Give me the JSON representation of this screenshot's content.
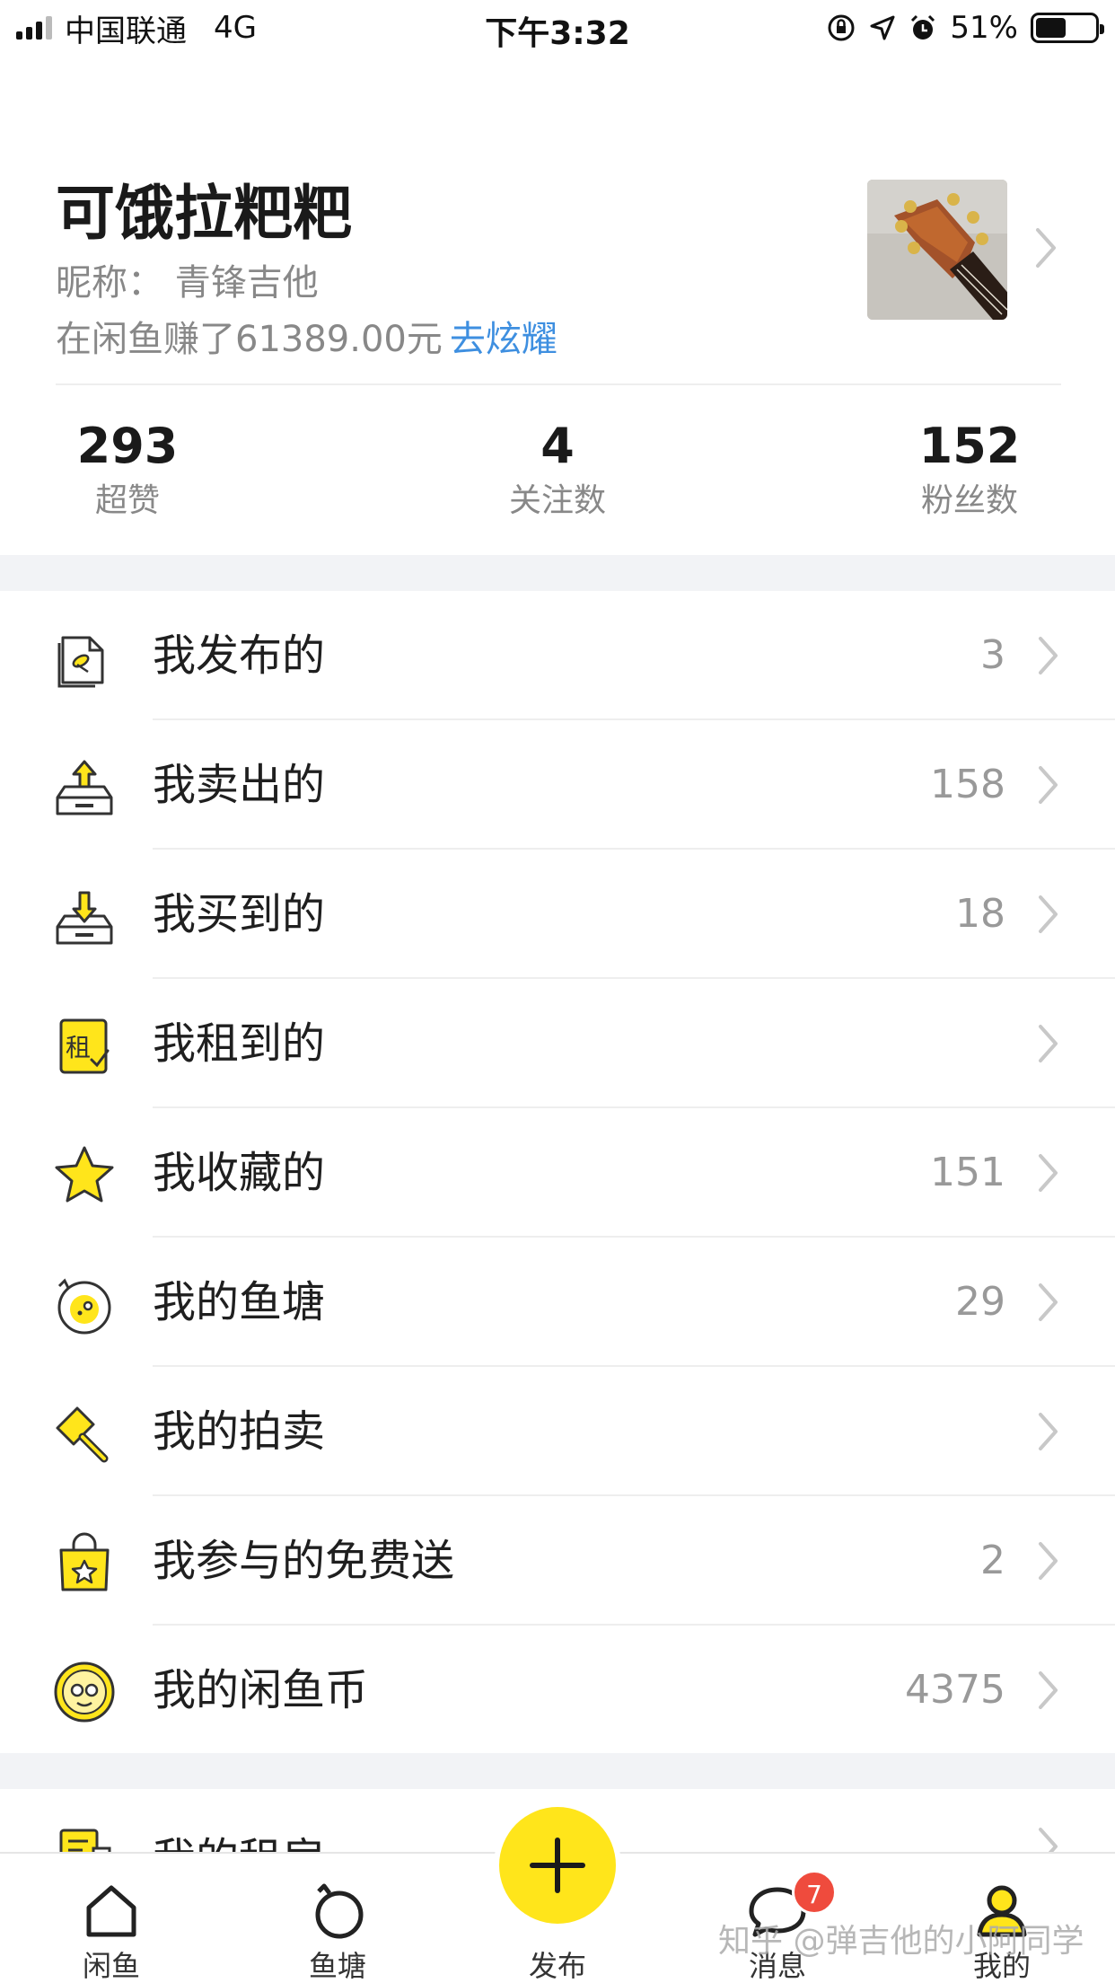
{
  "status_bar": {
    "carrier": "中国联通",
    "network": "4G",
    "time": "下午3:32",
    "battery": "51%",
    "battery_level": 0.51
  },
  "profile": {
    "name": "可饿拉粑粑",
    "nickname": "昵称： 青锋吉他",
    "earned_text": "在闲鱼赚了61389.00元",
    "show_off_link": "去炫耀"
  },
  "stats": [
    {
      "value": "293",
      "label": "超赞"
    },
    {
      "value": "4",
      "label": "关注数"
    },
    {
      "value": "152",
      "label": "粉丝数"
    }
  ],
  "menu": [
    {
      "label": "我发布的",
      "count": "3",
      "icon": "published-icon"
    },
    {
      "label": "我卖出的",
      "count": "158",
      "icon": "sold-icon"
    },
    {
      "label": "我买到的",
      "count": "18",
      "icon": "bought-icon"
    },
    {
      "label": "我租到的",
      "count": "",
      "icon": "rented-icon",
      "icon_text": "租"
    },
    {
      "label": "我收藏的",
      "count": "151",
      "icon": "favorites-star-icon"
    },
    {
      "label": "我的鱼塘",
      "count": "29",
      "icon": "fish-pond-icon"
    },
    {
      "label": "我的拍卖",
      "count": "",
      "icon": "auction-hammer-icon"
    },
    {
      "label": "我参与的免费送",
      "count": "2",
      "icon": "free-gift-bag-icon"
    },
    {
      "label": "我的闲鱼币",
      "count": "4375",
      "icon": "xianyu-coin-icon"
    }
  ],
  "partial_item": {
    "label": "我的租房"
  },
  "tabbar": {
    "items": [
      {
        "label": "闲鱼",
        "icon": "home-icon"
      },
      {
        "label": "鱼塘",
        "icon": "pond-icon"
      },
      {
        "label": "发布",
        "icon": "plus-icon"
      },
      {
        "label": "消息",
        "icon": "message-icon",
        "badge": "7"
      },
      {
        "label": "我的",
        "icon": "profile-icon"
      }
    ]
  },
  "watermark": "知乎 @弹吉他的小阿同学",
  "colors": {
    "accent_yellow": "#ffe51b",
    "link_blue": "#3e8fe0",
    "badge_red": "#ef4b3d",
    "section_gap": "#f2f3f6"
  }
}
